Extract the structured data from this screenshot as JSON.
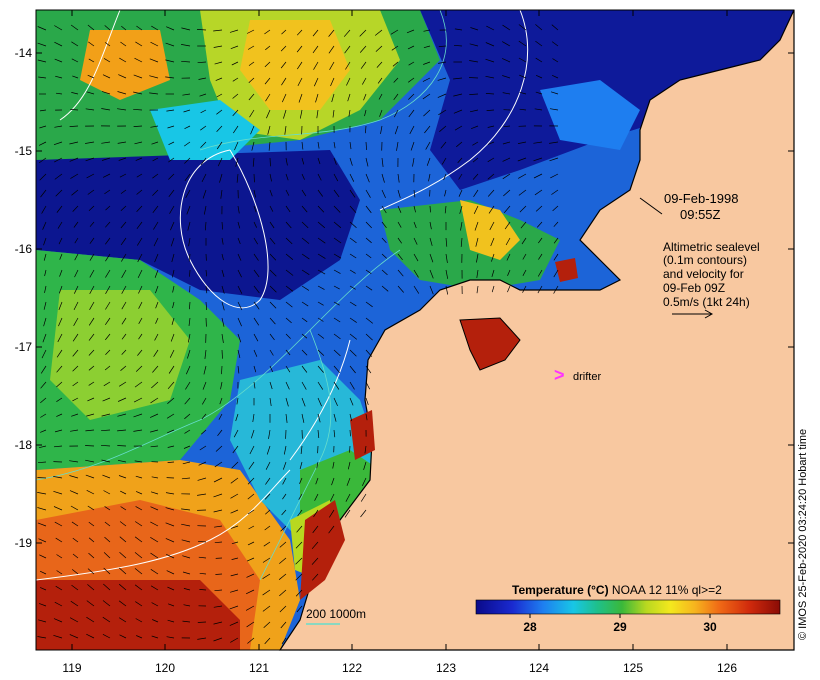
{
  "map": {
    "date": "09-Feb-1998",
    "time": "09:55Z",
    "legend_lines": [
      "Altimetric sealevel",
      "(0.1m contours)",
      "and velocity for",
      "09-Feb 09Z",
      "0.5m/s (1kt 24h)"
    ],
    "drifter_label": "drifter",
    "drifter_marker": ">",
    "scale_bar_label": "200  1000m",
    "credit": "© IMOS 25-Feb-2020 03:24:20 Hobart time",
    "colors": {
      "land": "#f8c8a0",
      "drifter": "#ff33ff",
      "contour": "#ffffff",
      "bathy": "#66ddcc"
    }
  },
  "axes": {
    "lat_labels": [
      "-14",
      "-15",
      "-16",
      "-17",
      "-18",
      "-19"
    ],
    "lon_labels": [
      "119",
      "120",
      "121",
      "122",
      "123",
      "124",
      "125",
      "126"
    ]
  },
  "colorbar": {
    "title_bold": "Temperature (°C)",
    "title_rest": " NOAA 12 11% ql>=2",
    "ticks": [
      "28",
      "29",
      "30"
    ],
    "range": [
      27.3,
      30.7
    ]
  }
}
